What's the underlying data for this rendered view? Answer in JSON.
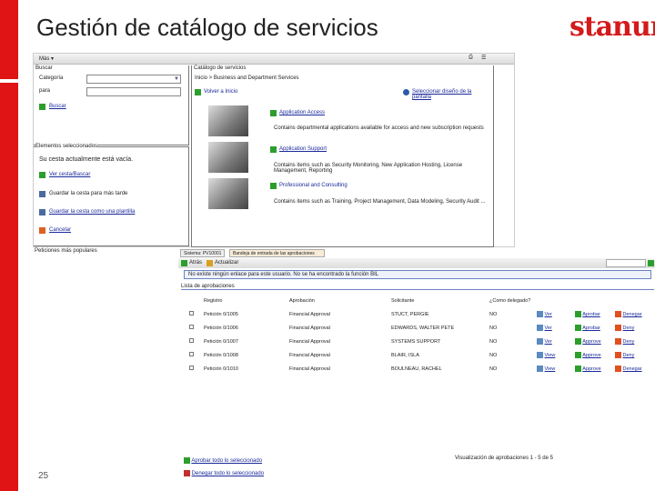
{
  "slide": {
    "title": "Gestión de catálogo de servicios",
    "logo": "stanum",
    "page_number": "25"
  },
  "catalog": {
    "menu": "Más ▾",
    "search": {
      "heading": "Buscar",
      "category_label": "Categoría",
      "for_label": "para",
      "category_value": "",
      "for_value": "",
      "search_link": "Buscar"
    },
    "basket": {
      "heading": "Elementos seleccionados",
      "empty": "Su cesta actualmente está vacía.",
      "view": "Ver cesta/Bascar",
      "save": "Guardar la cesta para más tarde",
      "template": "Guardar la cesta como una plantilla",
      "cancel": "Cancelar"
    },
    "popular": "Peticiones más populares",
    "main": {
      "heading": "Catálogo de servicios",
      "breadcrumb": "Inicio > Business and Department Services",
      "home": "Volver a Inicio",
      "alt_view": "Seleccionar diseño de la pantalla",
      "items": [
        {
          "name": "Application Access",
          "desc": "Contains departmental applications available for access and new subscription requests"
        },
        {
          "name": "Application Support",
          "desc": "Contains items such as Security Monitoring, New Application Hosting, License Management, Reporting"
        },
        {
          "name": "Professional and Consulting",
          "desc": "Contains items such as Training, Project Management, Data Modeling, Security Audit ..."
        }
      ]
    }
  },
  "approvals": {
    "tabs": [
      "Sistema: PV10001",
      "Bandeja de entrada de las aprobaciones"
    ],
    "toolbar": {
      "back": "Atrás",
      "refresh": "Actualizar"
    },
    "info": "No existe ningún enlace para este usuario. No se ha encontrado la función BIL",
    "list_title": "Lista de aprobaciones",
    "columns": [
      "Registro",
      "Aprobación",
      "Solicitante",
      "¿Como delegado?"
    ],
    "rows": [
      {
        "reg": "Petición 0/1005",
        "apr": "Financial Approval",
        "sol": "STUCT, PERGIE",
        "del": "NO",
        "view": "Ver",
        "approve": "Aprobar",
        "deny": "Denegar"
      },
      {
        "reg": "Petición 0/1006",
        "apr": "Financial Approval",
        "sol": "EDWARDS, WALTER PETE",
        "del": "NO",
        "view": "Ver",
        "approve": "Aprobar",
        "deny": "Deny"
      },
      {
        "reg": "Petición 0/1007",
        "apr": "Financial Approval",
        "sol": "SYSTEMS SUPPORT",
        "del": "NO",
        "view": "Ver",
        "approve": "Approve",
        "deny": "Deny"
      },
      {
        "reg": "Petición 0/1008",
        "apr": "Financial Approval",
        "sol": "BLAIR, ISLA",
        "del": "NO",
        "view": "View",
        "approve": "Approve",
        "deny": "Deny"
      },
      {
        "reg": "Petición 0/1010",
        "apr": "Financial Approval",
        "sol": "BOULNEAU, RACHEL",
        "del": "NO",
        "view": "View",
        "approve": "Approve",
        "deny": "Denegar"
      }
    ],
    "approve_all": "Aprobar todo lo seleccionado",
    "deny_all": "Denegar todo lo seleccionado",
    "pagination": "Visualización de aprobaciones 1 - 5 de 5"
  }
}
